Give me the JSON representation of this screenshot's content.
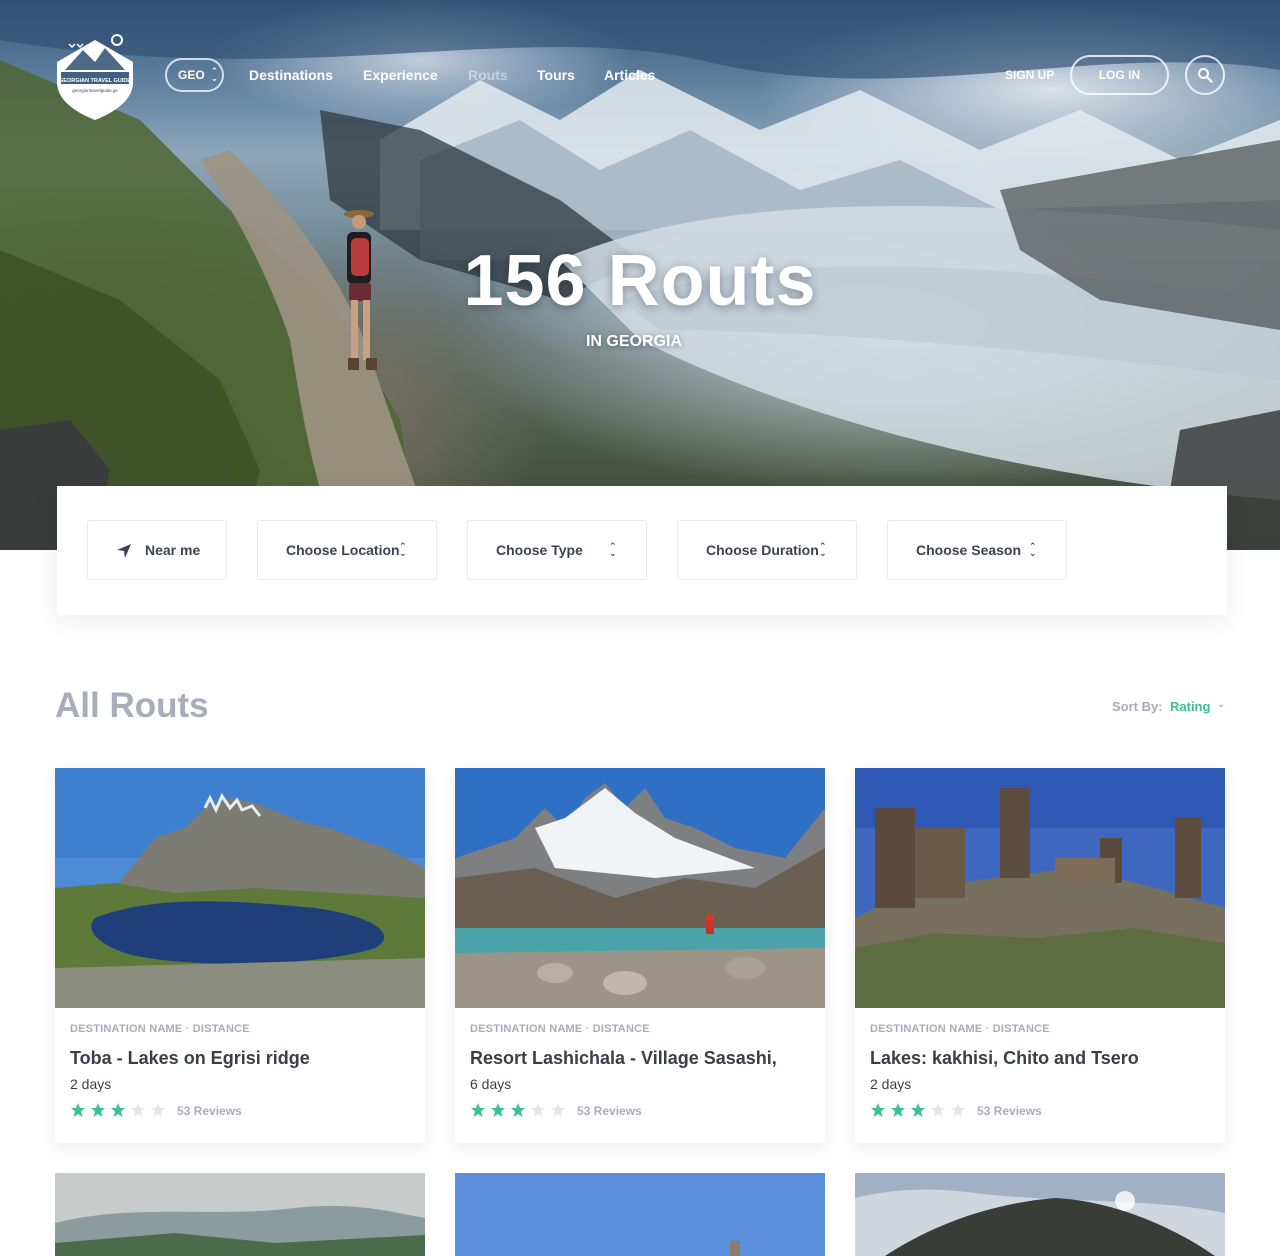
{
  "brand": {
    "logo_text_line1": "GEORGIAN TRAVEL GUIDE",
    "logo_text_line2": "georgiantravelguide.ge"
  },
  "nav": {
    "lang": "GEO",
    "links": [
      "Destinations",
      "Experience",
      "Routs",
      "Tours",
      "Articles"
    ],
    "active": "Routs",
    "signup": "SIGN UP",
    "login": "LOG IN"
  },
  "hero": {
    "title": "156 Routs",
    "subtitle": "IN GEORGIA"
  },
  "filters": {
    "near_me": "Near me",
    "location": "Choose Location",
    "type": "Choose Type",
    "duration": "Choose Duration",
    "season": "Choose Season"
  },
  "section": {
    "title": "All Routs",
    "sort_label": "Sort By:",
    "sort_value": "Rating"
  },
  "cards": [
    {
      "meta": "DESTINATION NAME · DISTANCE",
      "title": "Toba - Lakes on Egrisi ridge",
      "duration": "2 days",
      "rating": 3,
      "max_rating": 5,
      "reviews": "53 Reviews"
    },
    {
      "meta": "DESTINATION NAME · DISTANCE",
      "title": "Resort Lashichala - Village Sasashi,",
      "duration": "6 days",
      "rating": 3,
      "max_rating": 5,
      "reviews": "53 Reviews"
    },
    {
      "meta": "DESTINATION NAME · DISTANCE",
      "title": "Lakes: kakhisi, Chito and Tsero",
      "duration": "2 days",
      "rating": 3,
      "max_rating": 5,
      "reviews": "53 Reviews"
    }
  ],
  "colors": {
    "accent": "#3fbf97",
    "muted": "#a7adba",
    "text": "#3a3f47",
    "star_empty": "#e3e6ea"
  }
}
